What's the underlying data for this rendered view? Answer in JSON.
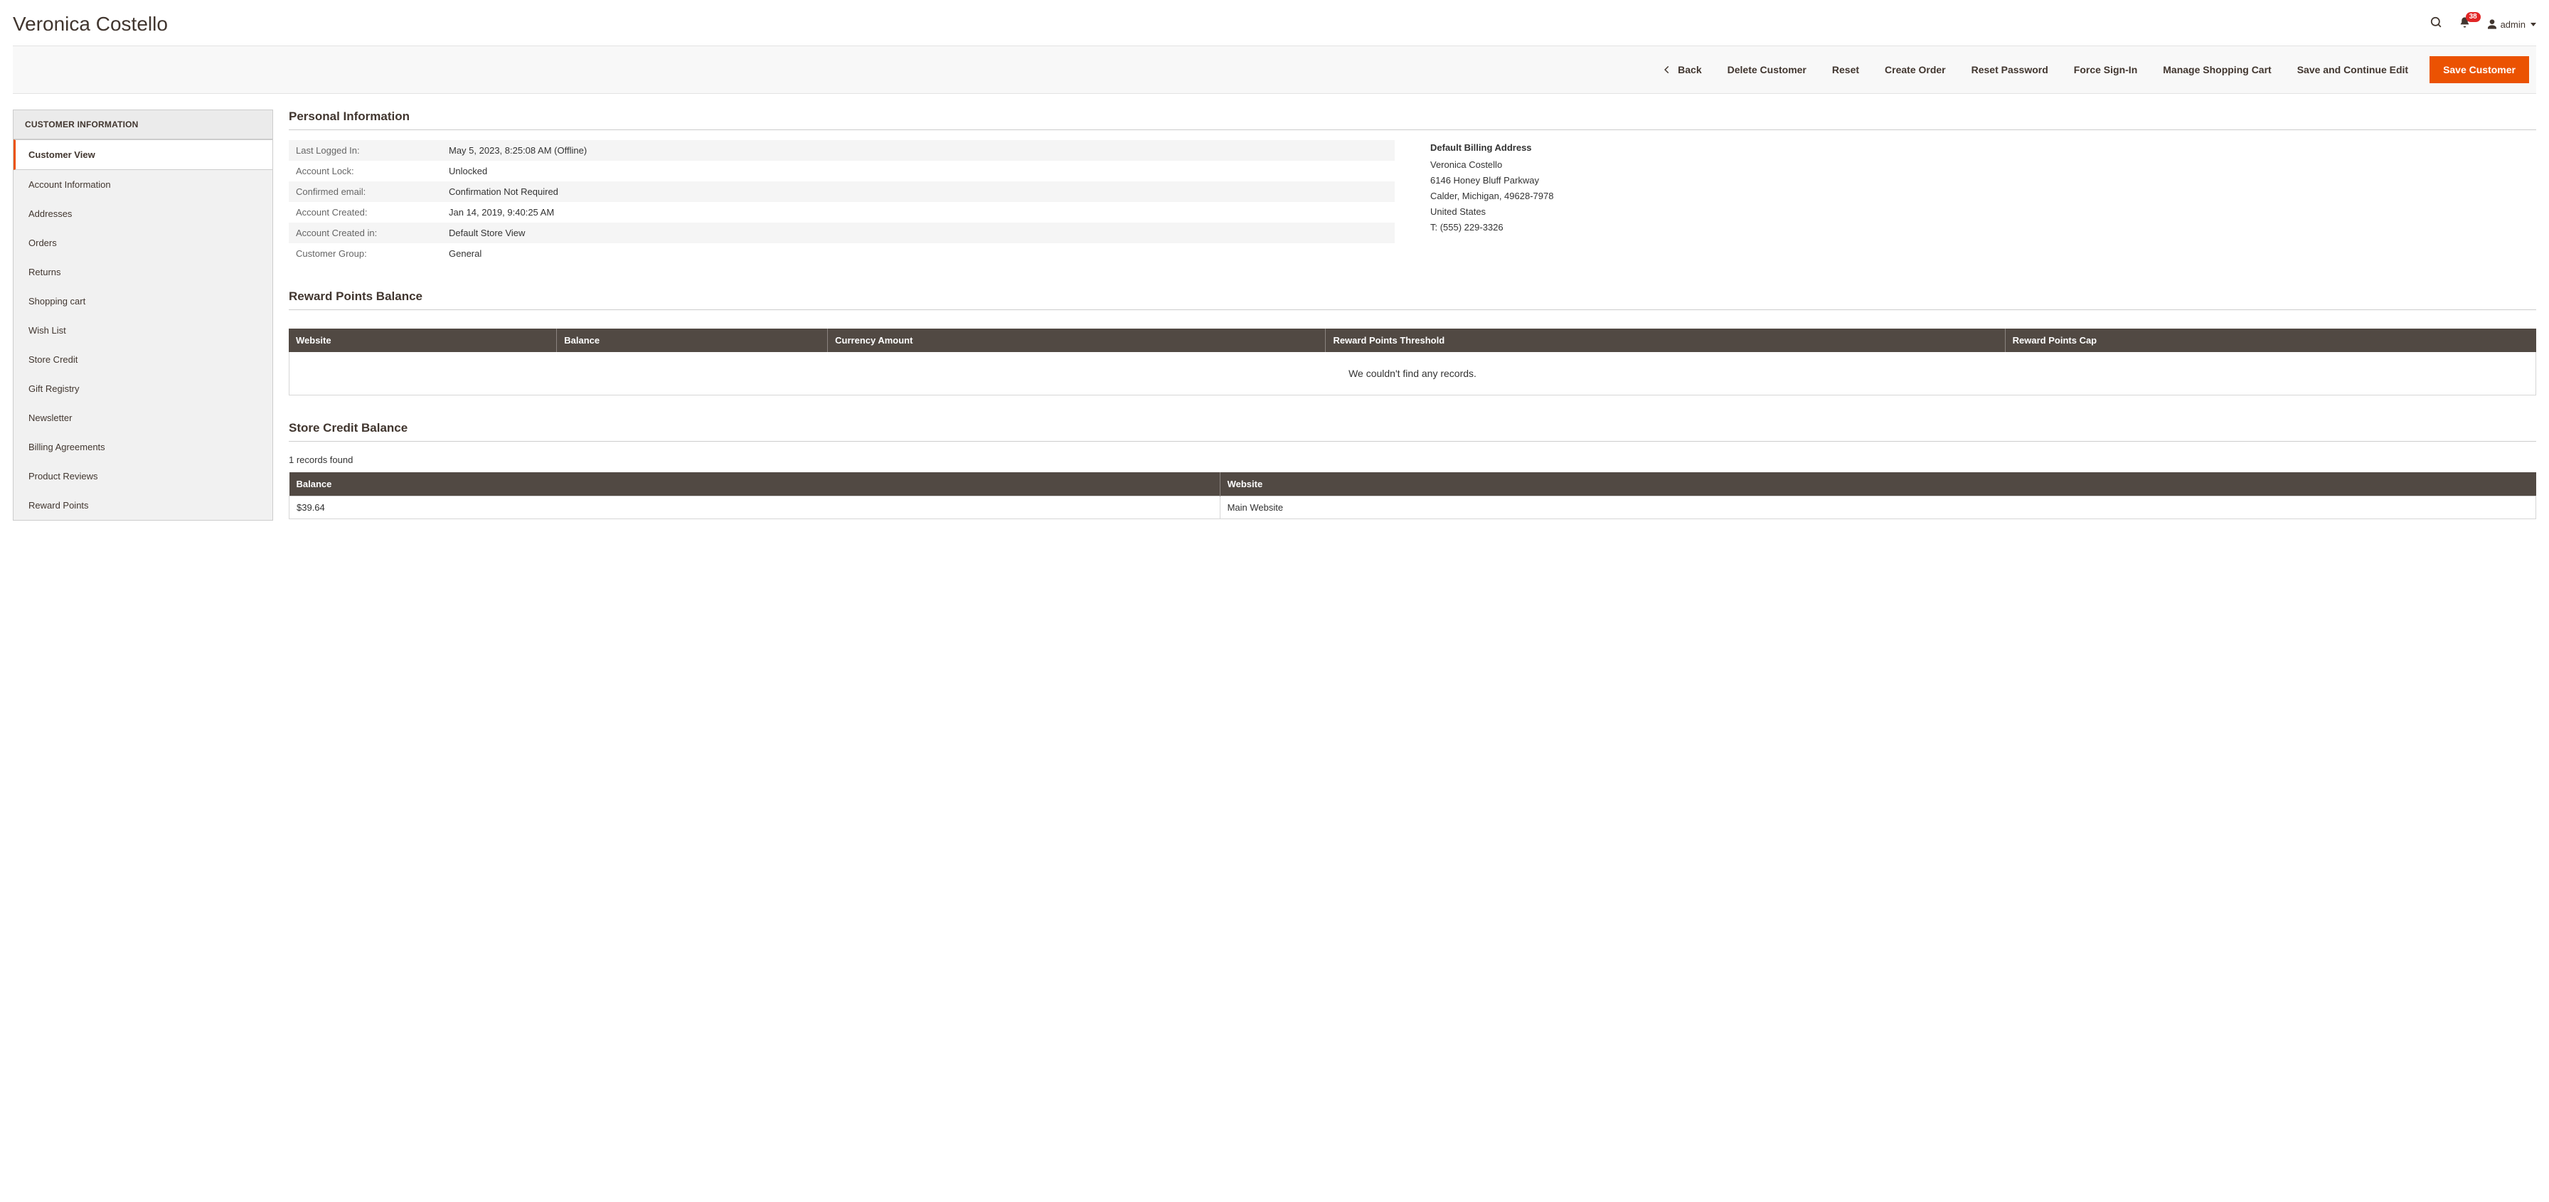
{
  "header": {
    "title": "Veronica Costello",
    "notification_count": "38",
    "admin_user": "admin"
  },
  "actions": {
    "back": "Back",
    "delete": "Delete Customer",
    "reset": "Reset",
    "create_order": "Create Order",
    "reset_password": "Reset Password",
    "force_signin": "Force Sign-In",
    "manage_cart": "Manage Shopping Cart",
    "save_continue": "Save and Continue Edit",
    "save": "Save Customer"
  },
  "sidebar": {
    "title": "CUSTOMER INFORMATION",
    "items": [
      "Customer View",
      "Account Information",
      "Addresses",
      "Orders",
      "Returns",
      "Shopping cart",
      "Wish List",
      "Store Credit",
      "Gift Registry",
      "Newsletter",
      "Billing Agreements",
      "Product Reviews",
      "Reward Points"
    ]
  },
  "personal": {
    "title": "Personal Information",
    "rows": [
      {
        "label": "Last Logged In:",
        "value": "May 5, 2023, 8:25:08 AM (Offline)"
      },
      {
        "label": "Account Lock:",
        "value": "Unlocked"
      },
      {
        "label": "Confirmed email:",
        "value": "Confirmation Not Required"
      },
      {
        "label": "Account Created:",
        "value": "Jan 14, 2019, 9:40:25 AM"
      },
      {
        "label": "Account Created in:",
        "value": "Default Store View"
      },
      {
        "label": "Customer Group:",
        "value": "General"
      }
    ],
    "address": {
      "title": "Default Billing Address",
      "name": "Veronica Costello",
      "street": "6146 Honey Bluff Parkway",
      "city_region_zip": "Calder, Michigan, 49628-7978",
      "country": "United States",
      "phone": "T: (555) 229-3326"
    }
  },
  "rewards": {
    "title": "Reward Points Balance",
    "columns": [
      "Website",
      "Balance",
      "Currency Amount",
      "Reward Points Threshold",
      "Reward Points Cap"
    ],
    "empty": "We couldn't find any records."
  },
  "store_credit": {
    "title": "Store Credit Balance",
    "records_found": "1 records found",
    "columns": [
      "Balance",
      "Website"
    ],
    "rows": [
      {
        "balance": "$39.64",
        "website": "Main Website"
      }
    ]
  }
}
